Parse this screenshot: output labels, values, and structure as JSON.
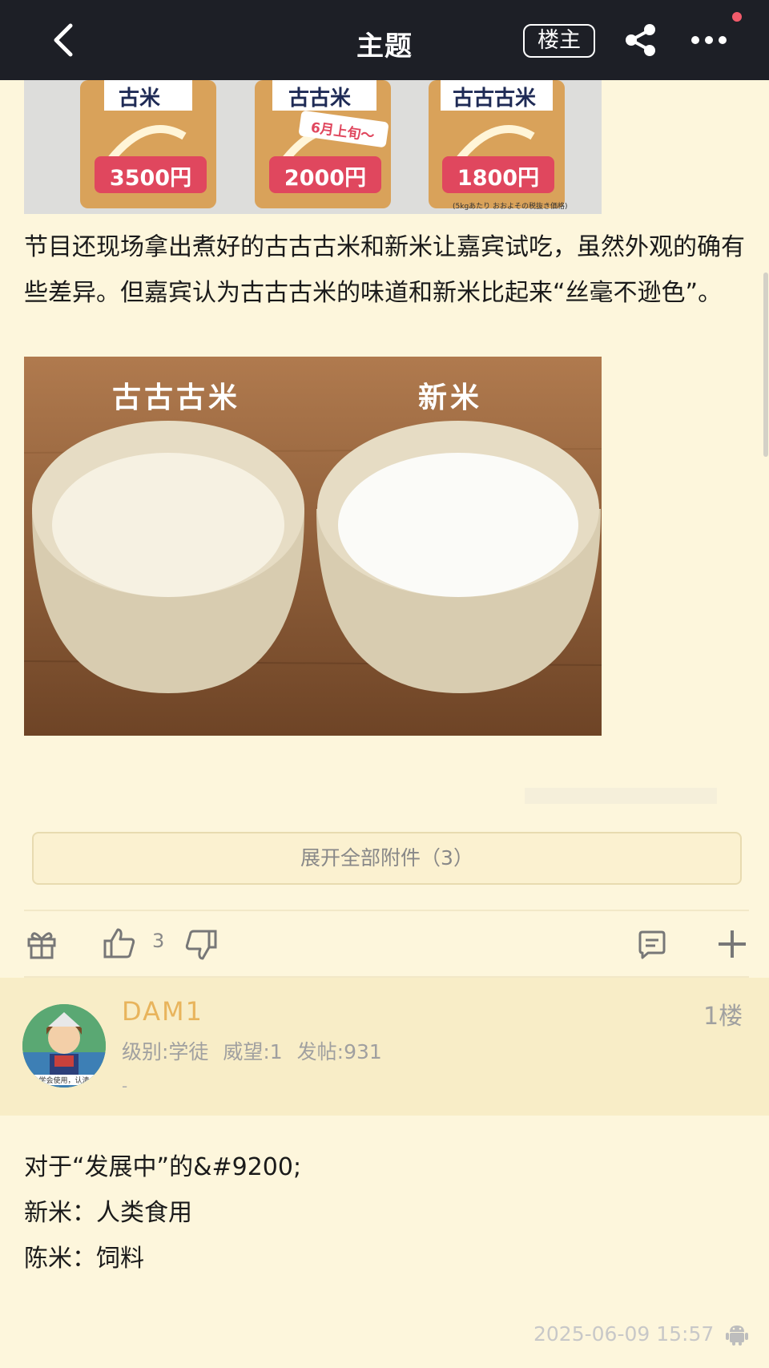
{
  "header": {
    "title": "主题",
    "owner_button": "楼主"
  },
  "post": {
    "image_top": {
      "bags": [
        {
          "label": "古米",
          "price": "3500円"
        },
        {
          "label": "古古米",
          "price": "2000円",
          "tag": "6月上旬〜"
        },
        {
          "label": "古古古米",
          "price": "1800円"
        }
      ],
      "footnote": "(5kgあたり おおよその税抜き価格)"
    },
    "paragraph": "节目还现场拿出煮好的古古古米和新米让嘉宾试吃，虽然外观的确有些差异。但嘉宾认为古古古米的味道和新米比起来“丝毫不逊色”。",
    "image_bowls": {
      "left_label": "古古古米",
      "right_label": "新米"
    },
    "expand_attachments": "展开全部附件（3）",
    "like_count": "3"
  },
  "reply": {
    "username": "DAM1",
    "floor": "1楼",
    "meta": "级别:学徒  威望:1  发帖:931",
    "signature": "-",
    "avatar_caption": "学会使用，认清",
    "lines": [
      "对于“发展中”的&#9200;",
      "新米：人类食用",
      "陈米：饲料"
    ],
    "timestamp": "2025-06-09 15:57"
  },
  "colors": {
    "background": "#fdf6dc",
    "topbar": "#1d1f26",
    "username": "#e8b45c",
    "notification_dot": "#f25b6b",
    "price_tag": "#e0475e"
  },
  "icons": [
    "back-arrow-icon",
    "share-icon",
    "more-icon",
    "gift-icon",
    "thumbs-up-icon",
    "thumbs-down-icon",
    "comment-icon",
    "plus-icon",
    "android-icon"
  ]
}
